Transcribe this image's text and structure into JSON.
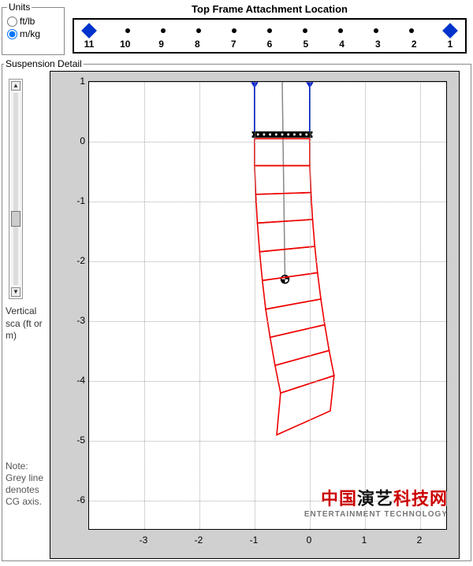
{
  "units": {
    "legend": "Units",
    "options": [
      {
        "label": "ft/lb",
        "checked": false
      },
      {
        "label": "m/kg",
        "checked": true
      }
    ]
  },
  "attachment": {
    "title": "Top Frame Attachment Location",
    "slots": [
      {
        "n": "11",
        "selected": true
      },
      {
        "n": "10",
        "selected": false
      },
      {
        "n": "9",
        "selected": false
      },
      {
        "n": "8",
        "selected": false
      },
      {
        "n": "7",
        "selected": false
      },
      {
        "n": "6",
        "selected": false
      },
      {
        "n": "5",
        "selected": false
      },
      {
        "n": "4",
        "selected": false
      },
      {
        "n": "3",
        "selected": false
      },
      {
        "n": "2",
        "selected": false
      },
      {
        "n": "1",
        "selected": true
      }
    ]
  },
  "detail": {
    "legend": "Suspension Detail",
    "y_axis_label": "Vertical sca (ft or m)",
    "note": "Note: Grey line denotes CG axis.",
    "x_range": [
      -4,
      2.5
    ],
    "y_range": [
      -6.5,
      1
    ],
    "y_ticks": [
      "1",
      "0",
      "-1",
      "-2",
      "-3",
      "-4",
      "-5",
      "-6"
    ],
    "x_ticks": [
      "-3",
      "-2",
      "-1",
      "0",
      "1",
      "2"
    ]
  },
  "chart_data": {
    "type": "line",
    "title": "Suspension Detail",
    "xlabel": "",
    "ylabel": "Vertical scale (ft or m)",
    "xlim": [
      -4,
      2.5
    ],
    "ylim": [
      -6.5,
      1
    ],
    "hang_points": {
      "left_x": -1.0,
      "right_x": 0.0,
      "top_y": 1.0,
      "frame_y": 0.15
    },
    "cg_line": {
      "x_top": -0.5,
      "y_top": 1.0,
      "x_cg": -0.45,
      "y_cg": -2.3
    },
    "frame_bar": {
      "x1": -1.05,
      "x2": 0.05,
      "y": 0.12
    },
    "cabinets": [
      {
        "tl": [
          -1.0,
          0.05
        ],
        "tr": [
          0.0,
          0.05
        ],
        "br": [
          0.0,
          -0.4
        ],
        "bl": [
          -1.0,
          -0.4
        ]
      },
      {
        "tl": [
          -1.0,
          -0.4
        ],
        "tr": [
          0.0,
          -0.4
        ],
        "br": [
          0.02,
          -0.85
        ],
        "bl": [
          -0.98,
          -0.88
        ]
      },
      {
        "tl": [
          -0.98,
          -0.88
        ],
        "tr": [
          0.02,
          -0.85
        ],
        "br": [
          0.05,
          -1.3
        ],
        "bl": [
          -0.95,
          -1.36
        ]
      },
      {
        "tl": [
          -0.95,
          -1.36
        ],
        "tr": [
          0.05,
          -1.3
        ],
        "br": [
          0.09,
          -1.75
        ],
        "bl": [
          -0.91,
          -1.84
        ]
      },
      {
        "tl": [
          -0.91,
          -1.84
        ],
        "tr": [
          0.09,
          -1.75
        ],
        "br": [
          0.14,
          -2.19
        ],
        "bl": [
          -0.86,
          -2.32
        ]
      },
      {
        "tl": [
          -0.86,
          -2.32
        ],
        "tr": [
          0.14,
          -2.19
        ],
        "br": [
          0.2,
          -2.63
        ],
        "bl": [
          -0.8,
          -2.8
        ]
      },
      {
        "tl": [
          -0.8,
          -2.8
        ],
        "tr": [
          0.2,
          -2.63
        ],
        "br": [
          0.27,
          -3.06
        ],
        "bl": [
          -0.72,
          -3.27
        ]
      },
      {
        "tl": [
          -0.72,
          -3.27
        ],
        "tr": [
          0.27,
          -3.06
        ],
        "br": [
          0.35,
          -3.49
        ],
        "bl": [
          -0.63,
          -3.74
        ]
      },
      {
        "tl": [
          -0.63,
          -3.74
        ],
        "tr": [
          0.35,
          -3.49
        ],
        "br": [
          0.44,
          -3.91
        ],
        "bl": [
          -0.53,
          -4.2
        ]
      },
      {
        "tl": [
          -0.53,
          -4.2
        ],
        "tr": [
          0.44,
          -3.91
        ],
        "br": [
          0.37,
          -4.5
        ],
        "bl": [
          -0.6,
          -4.9
        ]
      }
    ]
  },
  "watermark": {
    "cn_prefix": "中国",
    "cn_mid": "演艺",
    "cn_suffix": "科技网",
    "en": "ENTERTAINMENT TECHNOLOGY"
  }
}
